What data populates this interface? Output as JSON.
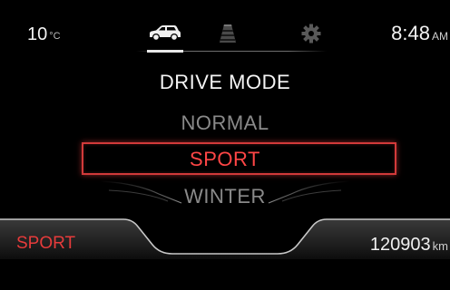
{
  "status": {
    "temperature": "10",
    "temperature_unit": "°C",
    "time": "8:48",
    "time_suffix": "AM"
  },
  "tabs": [
    {
      "icon": "car-icon",
      "active": true
    },
    {
      "icon": "lane-assist-icon",
      "active": false
    },
    {
      "icon": "gear-icon",
      "active": false
    }
  ],
  "menu": {
    "title": "DRIVE MODE",
    "items": [
      "NORMAL",
      "SPORT",
      "WINTER"
    ],
    "selected": "SPORT"
  },
  "footer": {
    "active_mode": "SPORT",
    "odometer": "120903",
    "odometer_unit": "km"
  },
  "colors": {
    "accent_red": "#e63b3b",
    "background": "#000000",
    "text": "#f2f2f2",
    "inactive_text": "#8a8a8a"
  }
}
